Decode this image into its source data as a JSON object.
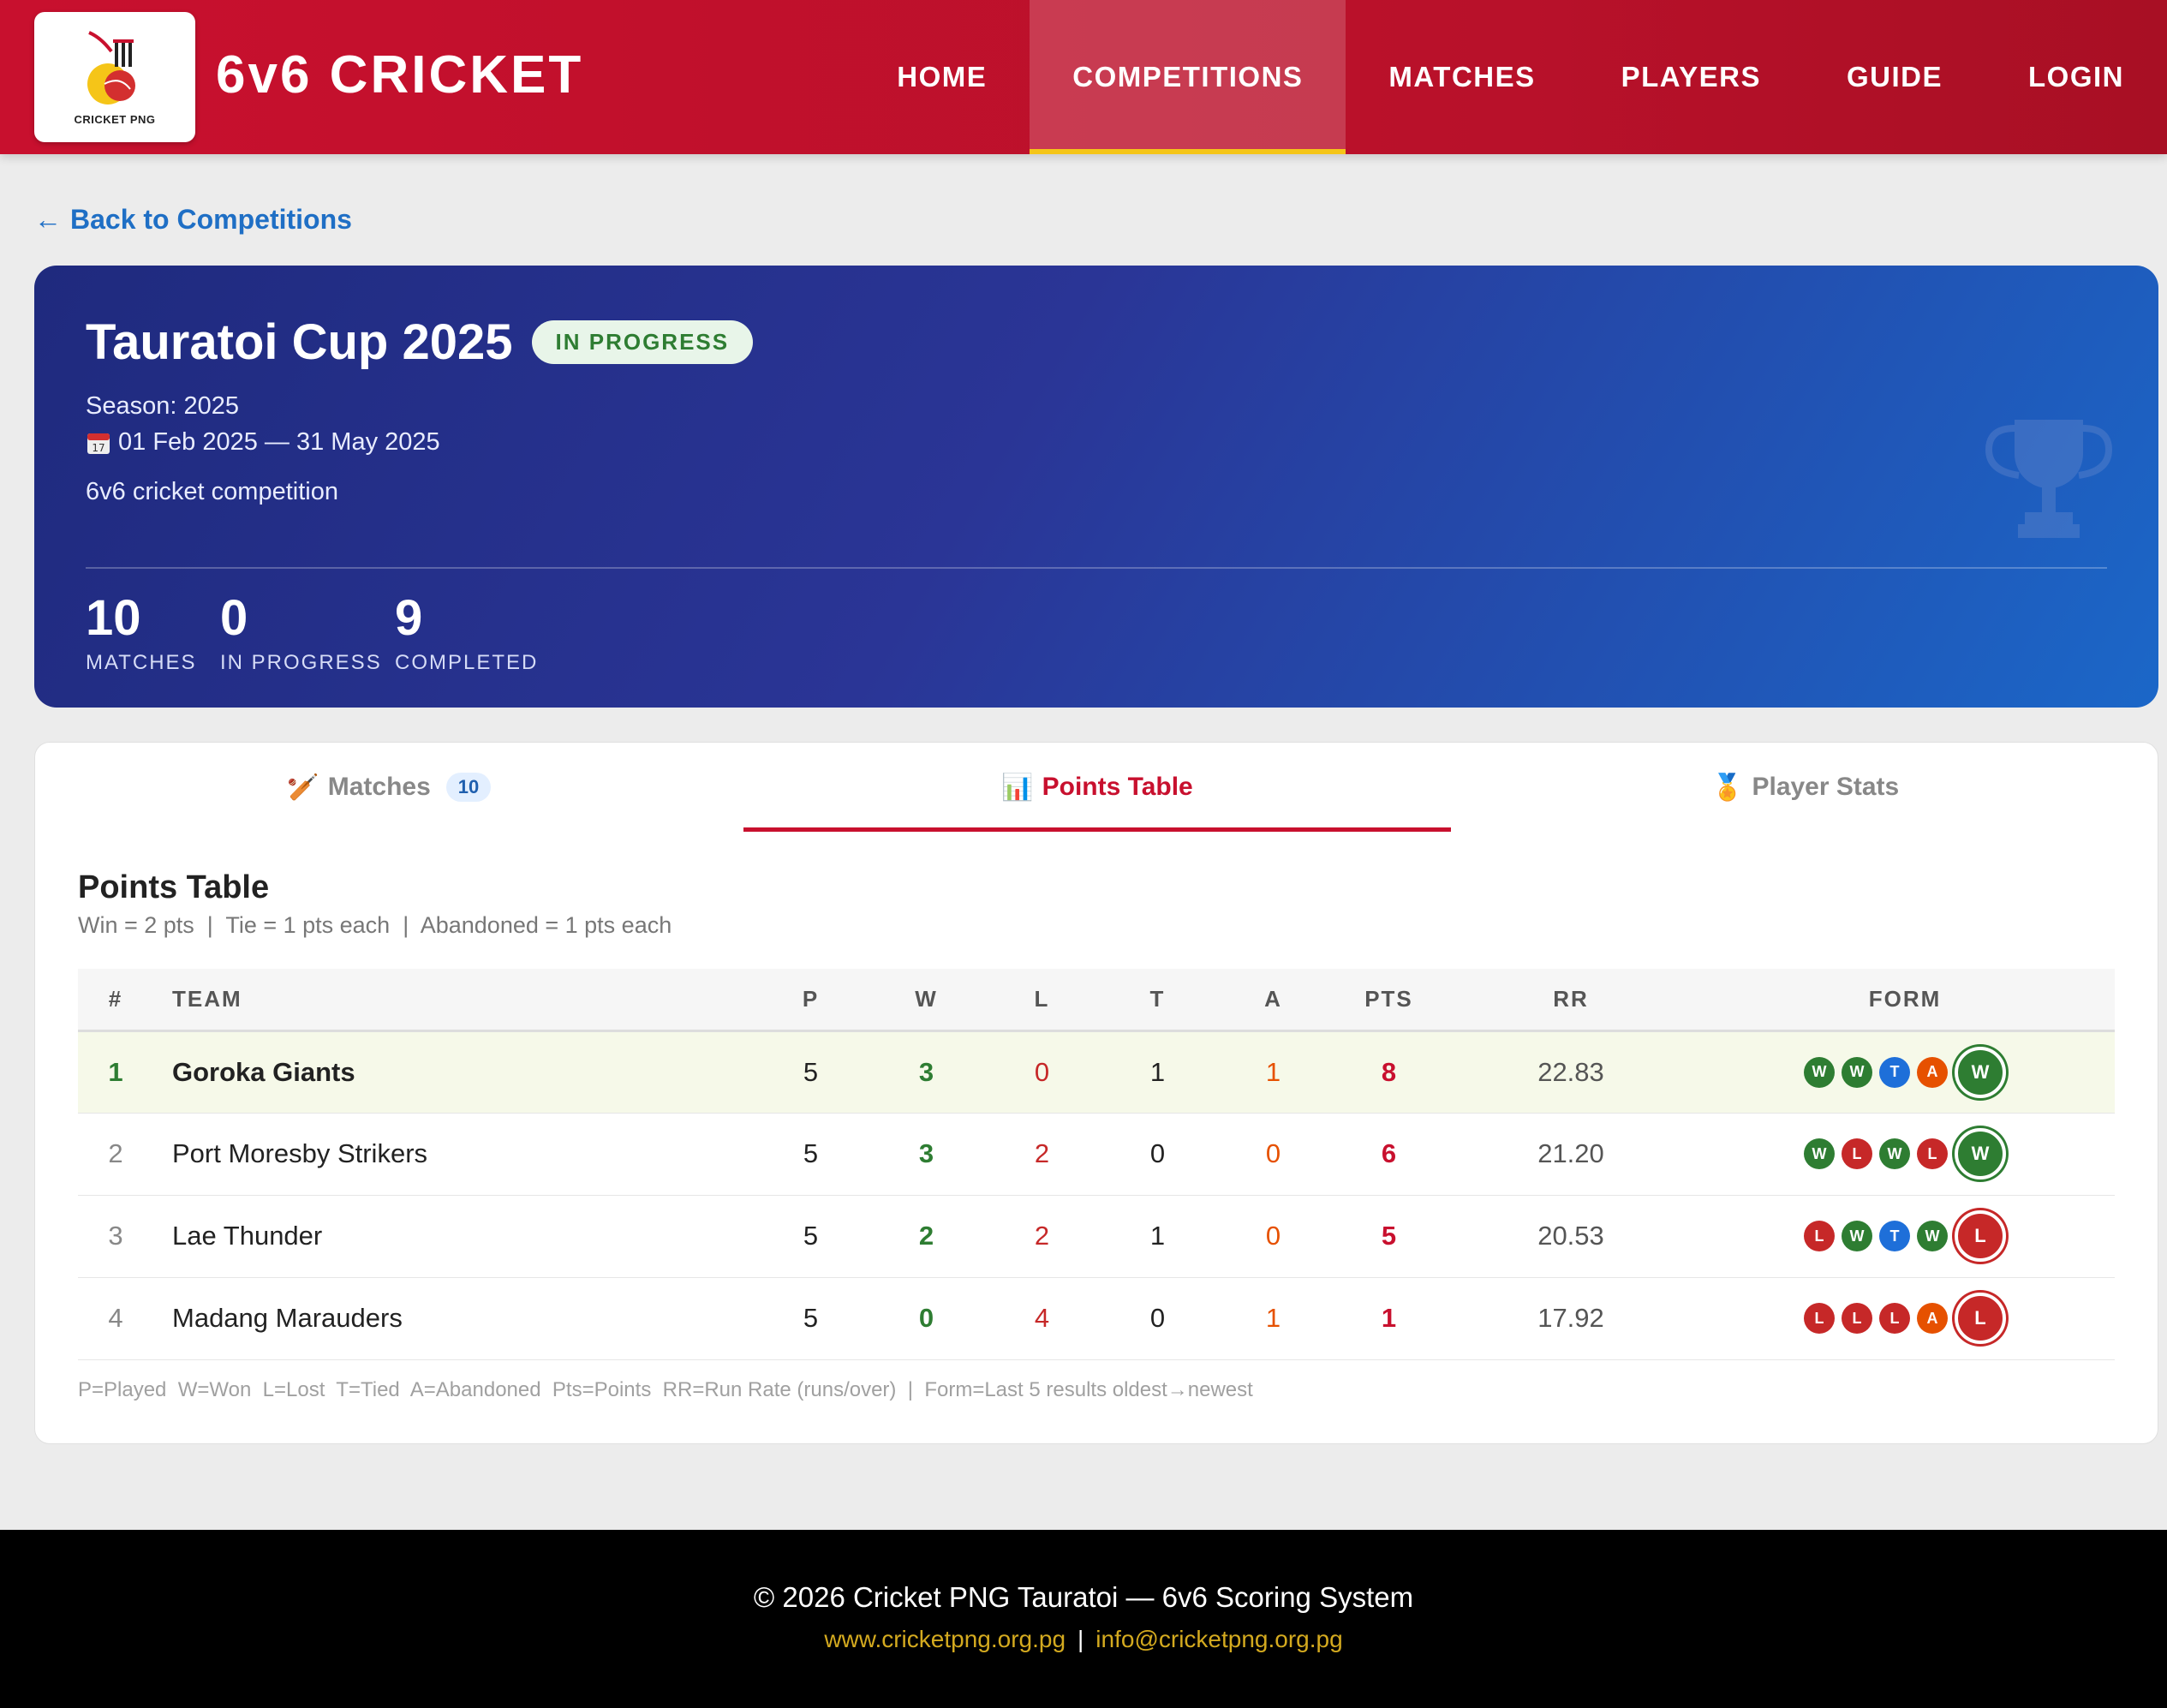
{
  "header": {
    "logo_text": "CRICKET PNG",
    "brand": "6v6 CRICKET",
    "nav": [
      {
        "label": "HOME"
      },
      {
        "label": "COMPETITIONS"
      },
      {
        "label": "MATCHES"
      },
      {
        "label": "PLAYERS"
      },
      {
        "label": "GUIDE"
      },
      {
        "label": "LOGIN"
      }
    ],
    "active_nav": "COMPETITIONS"
  },
  "back_link": "Back to Competitions",
  "competition": {
    "title": "Tauratoi Cup 2025",
    "status": "IN PROGRESS",
    "season": "Season: 2025",
    "dates": "01 Feb 2025 — 31 May 2025",
    "description": "6v6 cricket competition",
    "stats": [
      {
        "value": "10",
        "label": "MATCHES"
      },
      {
        "value": "0",
        "label": "IN PROGRESS"
      },
      {
        "value": "9",
        "label": "COMPLETED"
      }
    ]
  },
  "tabs": [
    {
      "label": "Matches",
      "count": "10",
      "icon": "cricket-bat-icon"
    },
    {
      "label": "Points Table",
      "icon": "bar-chart-icon"
    },
    {
      "label": "Player Stats",
      "icon": "medal-icon"
    }
  ],
  "points_table": {
    "title": "Points Table",
    "subtitle": "Win = 2 pts  |  Tie = 1 pts each  |  Abandoned = 1 pts each",
    "columns": [
      "#",
      "TEAM",
      "P",
      "W",
      "L",
      "T",
      "A",
      "PTS",
      "RR",
      "FORM"
    ],
    "rows": [
      {
        "rank": "1",
        "team": "Goroka Giants",
        "p": "5",
        "w": "3",
        "l": "0",
        "t": "1",
        "a": "1",
        "pts": "8",
        "rr": "22.83",
        "form": [
          "W",
          "W",
          "T",
          "A",
          "W"
        ]
      },
      {
        "rank": "2",
        "team": "Port Moresby Strikers",
        "p": "5",
        "w": "3",
        "l": "2",
        "t": "0",
        "a": "0",
        "pts": "6",
        "rr": "21.20",
        "form": [
          "W",
          "L",
          "W",
          "L",
          "W"
        ]
      },
      {
        "rank": "3",
        "team": "Lae Thunder",
        "p": "5",
        "w": "2",
        "l": "2",
        "t": "1",
        "a": "0",
        "pts": "5",
        "rr": "20.53",
        "form": [
          "L",
          "W",
          "T",
          "W",
          "L"
        ]
      },
      {
        "rank": "4",
        "team": "Madang Marauders",
        "p": "5",
        "w": "0",
        "l": "4",
        "t": "0",
        "a": "1",
        "pts": "1",
        "rr": "17.92",
        "form": [
          "L",
          "L",
          "L",
          "A",
          "L"
        ]
      }
    ],
    "legend": "P=Played  W=Won  L=Lost  T=Tied  A=Abandoned  Pts=Points  RR=Run Rate (runs/over)  |  Form=Last 5 results oldest→newest"
  },
  "footer": {
    "copyright": "© 2026 Cricket PNG Tauratoi — 6v6 Scoring System",
    "website": "www.cricketpng.org.pg",
    "email": "info@cricketpng.org.pg"
  },
  "colors": {
    "brand_red": "#c8102e",
    "hero_blue": "#2a3596",
    "win_green": "#2e7d32",
    "loss_red": "#c62828",
    "tie_blue": "#1e6fd9",
    "abandoned_orange": "#e65100",
    "accent_yellow": "#f5c518"
  }
}
